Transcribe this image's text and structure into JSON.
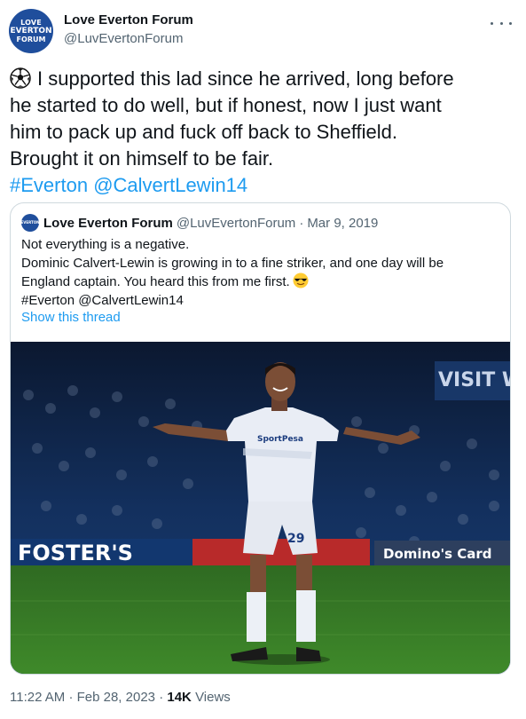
{
  "author": {
    "name": "Love Everton Forum",
    "handle": "@LuvEvertonForum",
    "avatar_lines": [
      "LOVE",
      "EVERTON",
      "FORUM"
    ],
    "avatar_color": "#1f4e9c"
  },
  "tweet": {
    "lines": [
      "I supported this lad since he arrived, long before",
      "he started to do well, but if honest, now I just want",
      "him to pack up and fuck off back to Sheffield.",
      "Brought it on himself to be fair."
    ],
    "leading_icon": "soccer-ball-icon",
    "hashtag": "#Everton",
    "mention": "@CalvertLewin14"
  },
  "quoted": {
    "name": "Love Everton Forum",
    "handle": "@LuvEvertonForum",
    "separator": "·",
    "date": "Mar 9, 2019",
    "lines": [
      "Not everything is a negative.",
      "Dominic Calvert-Lewin is growing in to a fine striker, and one day will be",
      "England captain. You heard this from me first."
    ],
    "trailing_icon": "sunglasses-face-icon",
    "tags_line": "#Everton @CalvertLewin14",
    "show_thread": "Show this thread",
    "photo": {
      "shirt_sponsor": "SportPesa",
      "shirt_number": "29",
      "boards": [
        "FOSTER'S",
        "Domino's Card"
      ]
    }
  },
  "footer": {
    "time": "11:22 AM",
    "separator": "·",
    "date": "Feb 28, 2023",
    "separator2": "·",
    "views_count": "14K",
    "views_label": "Views"
  },
  "colors": {
    "link": "#1d9bf0",
    "text": "#0f1419",
    "secondary": "#536471",
    "border": "#cfd9de"
  }
}
